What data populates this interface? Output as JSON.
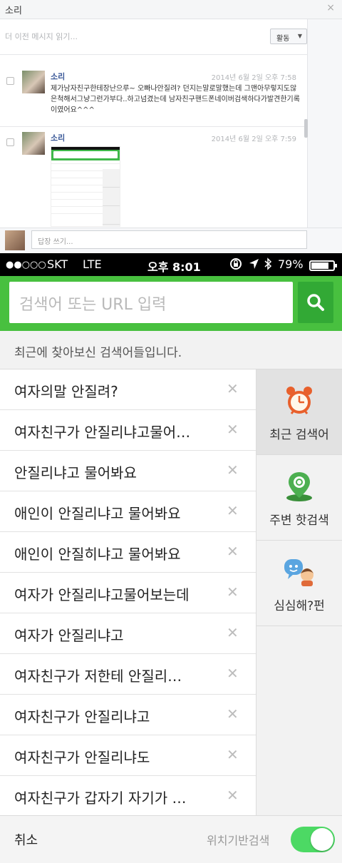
{
  "messenger": {
    "title": "소리",
    "close_glyph": "×",
    "older_messages": "더 이전 메시지 읽기...",
    "action_label": "활동",
    "messages": [
      {
        "name": "소리",
        "time": "2014년 6월 2일 오후 7:58",
        "text": "제가남자친구한테장난으루~ 오빠나안질려? 던지는말로말했는데 그맨아무렇지도않은척해서그냥그런가부다..하고넘겼는데 남자친구핸드폰네이버검색하다가발견한기록이였어요^^^"
      },
      {
        "name": "소리",
        "time": "2014년 6월 2일 오후 7:59"
      }
    ],
    "reply_placeholder": "답장 쓰기..."
  },
  "app": {
    "status": {
      "signal": "●●○○○",
      "carrier": "SKT",
      "network": "LTE",
      "time": "오후 8:01",
      "battery": "79%",
      "battery_level": 0.79
    },
    "search_placeholder": "검색어 또는 URL 입력",
    "hint": "최근에 찾아보신 검색어들입니다.",
    "recent": [
      "여자의말 안질려?",
      "여자친구가 안질리냐고물어…",
      "안질리냐고 물어봐요",
      "애인이 안질리냐고 물어봐요",
      "애인이 안질히냐고 물어봐요",
      "여자가 안질리냐고물어보는데",
      "여자가 안질리냐고",
      "여자친구가 저한테 안질리…",
      "여자친구가 안질리냐고",
      "여자친구가 안질리냐도",
      "여자친구가 갑자기 자기가 …"
    ],
    "delete_glyph": "✕",
    "tabs": [
      {
        "label": "최근 검색어",
        "icon": "alarm-clock-icon"
      },
      {
        "label": "주변 핫검색",
        "icon": "map-pin-icon"
      },
      {
        "label": "심심해?펀",
        "icon": "chat-face-icon"
      }
    ],
    "bottom": {
      "cancel": "취소",
      "geo_label": "위치기반검색",
      "geo_enabled": true
    },
    "colors": {
      "brand_green": "#48c03f",
      "toggle_on": "#4cd964"
    }
  }
}
